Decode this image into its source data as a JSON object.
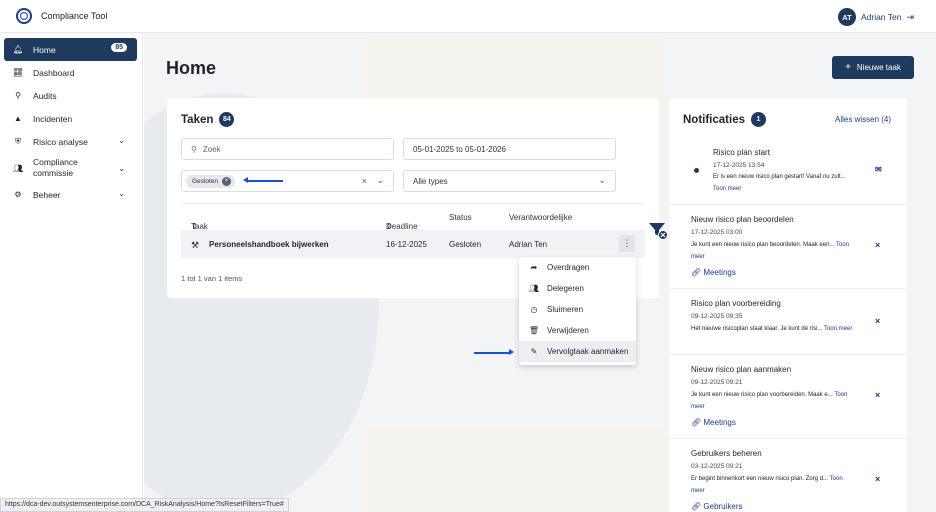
{
  "header": {
    "app_title": "Compliance Tool",
    "user_initials": "AT",
    "user_name": "Adrian Ten",
    "logout_icon": "logout-icon"
  },
  "sidebar": {
    "items": [
      {
        "label": "Home",
        "icon": "bell-icon",
        "badge": "85"
      },
      {
        "label": "Dashboard",
        "icon": "chart-icon"
      },
      {
        "label": "Audits",
        "icon": "audit-icon"
      },
      {
        "label": "Incidenten",
        "icon": "warning-icon"
      },
      {
        "label": "Risico analyse",
        "icon": "shield-icon"
      },
      {
        "label": "Compliance commissie",
        "icon": "people-icon"
      },
      {
        "label": "Beheer",
        "icon": "gear-icon"
      }
    ]
  },
  "page": {
    "title": "Home",
    "new_task": "Nieuwe taak"
  },
  "tasks": {
    "title": "Taken",
    "count": "84",
    "search_placeholder": "Zoek",
    "date_range": "05-01-2025 to 05-01-2026",
    "status_chip": "Gesloten",
    "type_select": "Alle types",
    "columns": [
      "Taak",
      "Deadline",
      "Status",
      "Verantwoordelijke"
    ],
    "rows": [
      {
        "task": "Personeelshandboek bijwerken",
        "deadline": "16-12-2025",
        "status": "Gesloten",
        "owner": "Adrian Ten"
      }
    ],
    "pager": "1 tot 1 van 1 items",
    "menu": [
      "Overdragen",
      "Delegeren",
      "Sluimeren",
      "Verwijderen",
      "Vervolgtaak aanmaken"
    ]
  },
  "notifications": {
    "title": "Notificaties",
    "count": "1",
    "clear": "Alles wissen (4)",
    "items": [
      {
        "title": "Risico plan start",
        "date": "17-12-2025 13:54",
        "message": "Er is een nieuw risico plan gestart! Vanaf nu zult...",
        "more": "Toon meer",
        "link": ""
      },
      {
        "title": "Nieuw risico plan beoordelen",
        "date": "17-12-2025 03:00",
        "message": "Je kunt een nieuw risico plan beoordelen. Maak een...",
        "more": "Toon meer",
        "link": "Meetings"
      },
      {
        "title": "Risico plan voorbereiding",
        "date": "09-12-2025 09:35",
        "message": "Het nieuwe risicoplan staat klaar. Je kunt de risi...",
        "more": "Toon meer",
        "link": ""
      },
      {
        "title": "Nieuw risico plan aanmaken",
        "date": "09-12-2025 09:21",
        "message": "Je kunt een nieuw risico plan voorbereiden. Maak e...",
        "more": "Toon meer",
        "link": "Meetings"
      },
      {
        "title": "Gebruikers beheren",
        "date": "03-12-2025 09:21",
        "message": "Er begint binnenkort een nieuw risico plan. Zorg d...",
        "more": "Toon meer",
        "link": "Gebruikers"
      }
    ]
  },
  "statusbar": {
    "url": "https://dca-dev.outsystemsenterprise.com/DCA_RiskAnalysis/Home?IsResetFilters=True#"
  }
}
